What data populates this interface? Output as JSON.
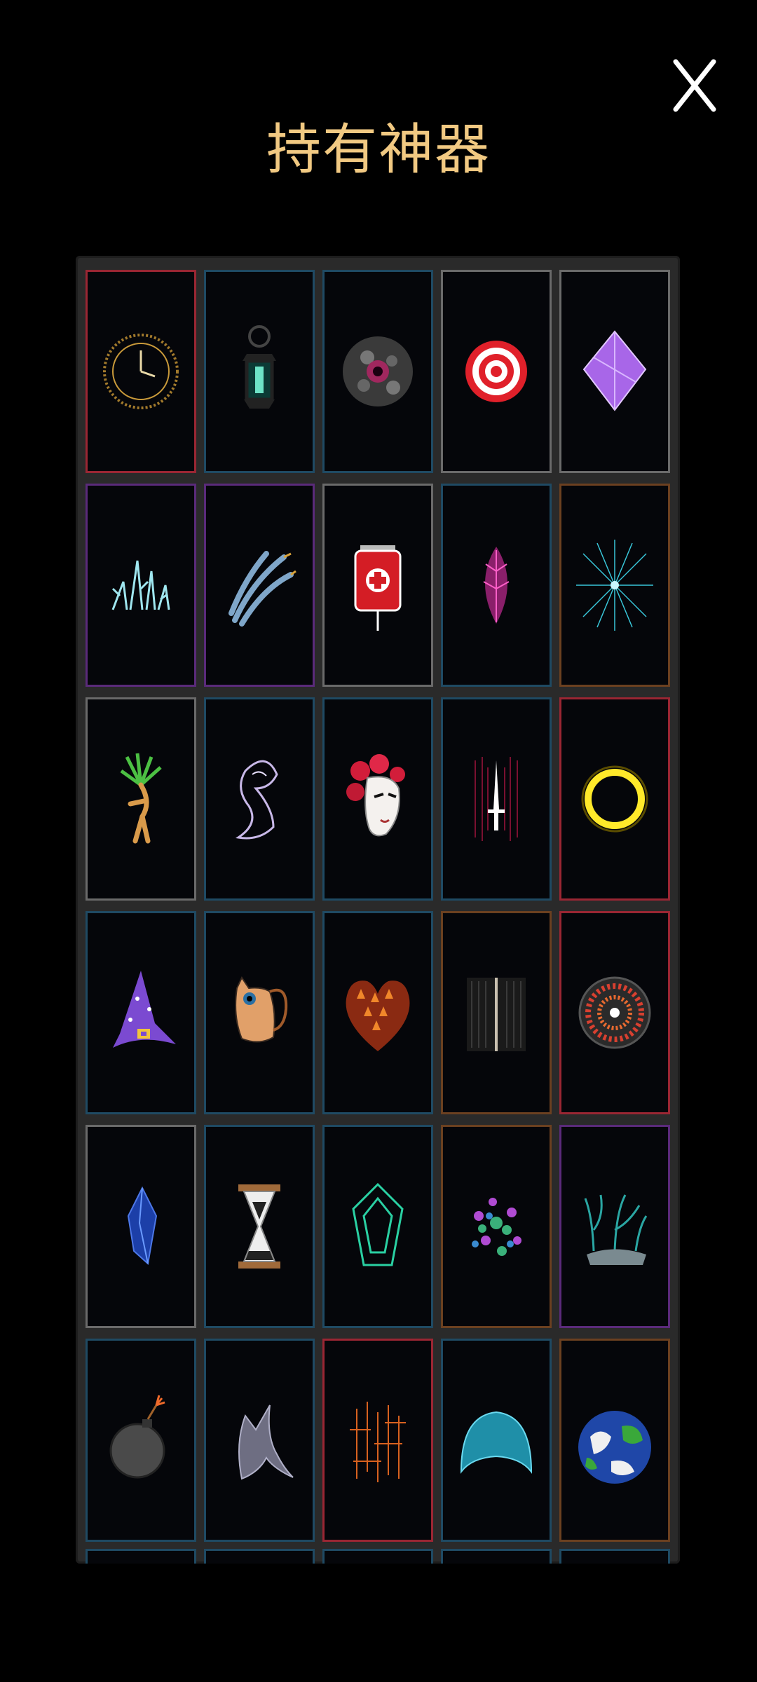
{
  "title": "持有神器",
  "close_label": "X",
  "colors": {
    "title": "#f1c982",
    "panel": "#2a2a2a",
    "background": "#000000"
  },
  "artifacts": [
    {
      "icon": "clock-icon"
    },
    {
      "icon": "lantern-icon"
    },
    {
      "icon": "dark-orb-icon"
    },
    {
      "icon": "target-icon"
    },
    {
      "icon": "purple-crystal-icon"
    },
    {
      "icon": "ice-shards-icon"
    },
    {
      "icon": "feathers-icon"
    },
    {
      "icon": "blood-bag-icon"
    },
    {
      "icon": "pink-leaf-icon"
    },
    {
      "icon": "star-burst-icon"
    },
    {
      "icon": "mandrake-icon"
    },
    {
      "icon": "ghost-icon"
    },
    {
      "icon": "rose-mask-icon"
    },
    {
      "icon": "dagger-icon"
    },
    {
      "icon": "gold-ring-icon"
    },
    {
      "icon": "wizard-hat-icon"
    },
    {
      "icon": "cat-bag-icon"
    },
    {
      "icon": "flame-heart-icon"
    },
    {
      "icon": "static-rune-icon"
    },
    {
      "icon": "eye-disc-icon"
    },
    {
      "icon": "blue-gem-icon"
    },
    {
      "icon": "hourglass-icon"
    },
    {
      "icon": "green-crystal-icon"
    },
    {
      "icon": "flower-cluster-icon"
    },
    {
      "icon": "coral-roots-icon"
    },
    {
      "icon": "bomb-icon"
    },
    {
      "icon": "grey-wing-icon"
    },
    {
      "icon": "ember-lines-icon"
    },
    {
      "icon": "blue-dome-icon"
    },
    {
      "icon": "earth-icon"
    }
  ]
}
